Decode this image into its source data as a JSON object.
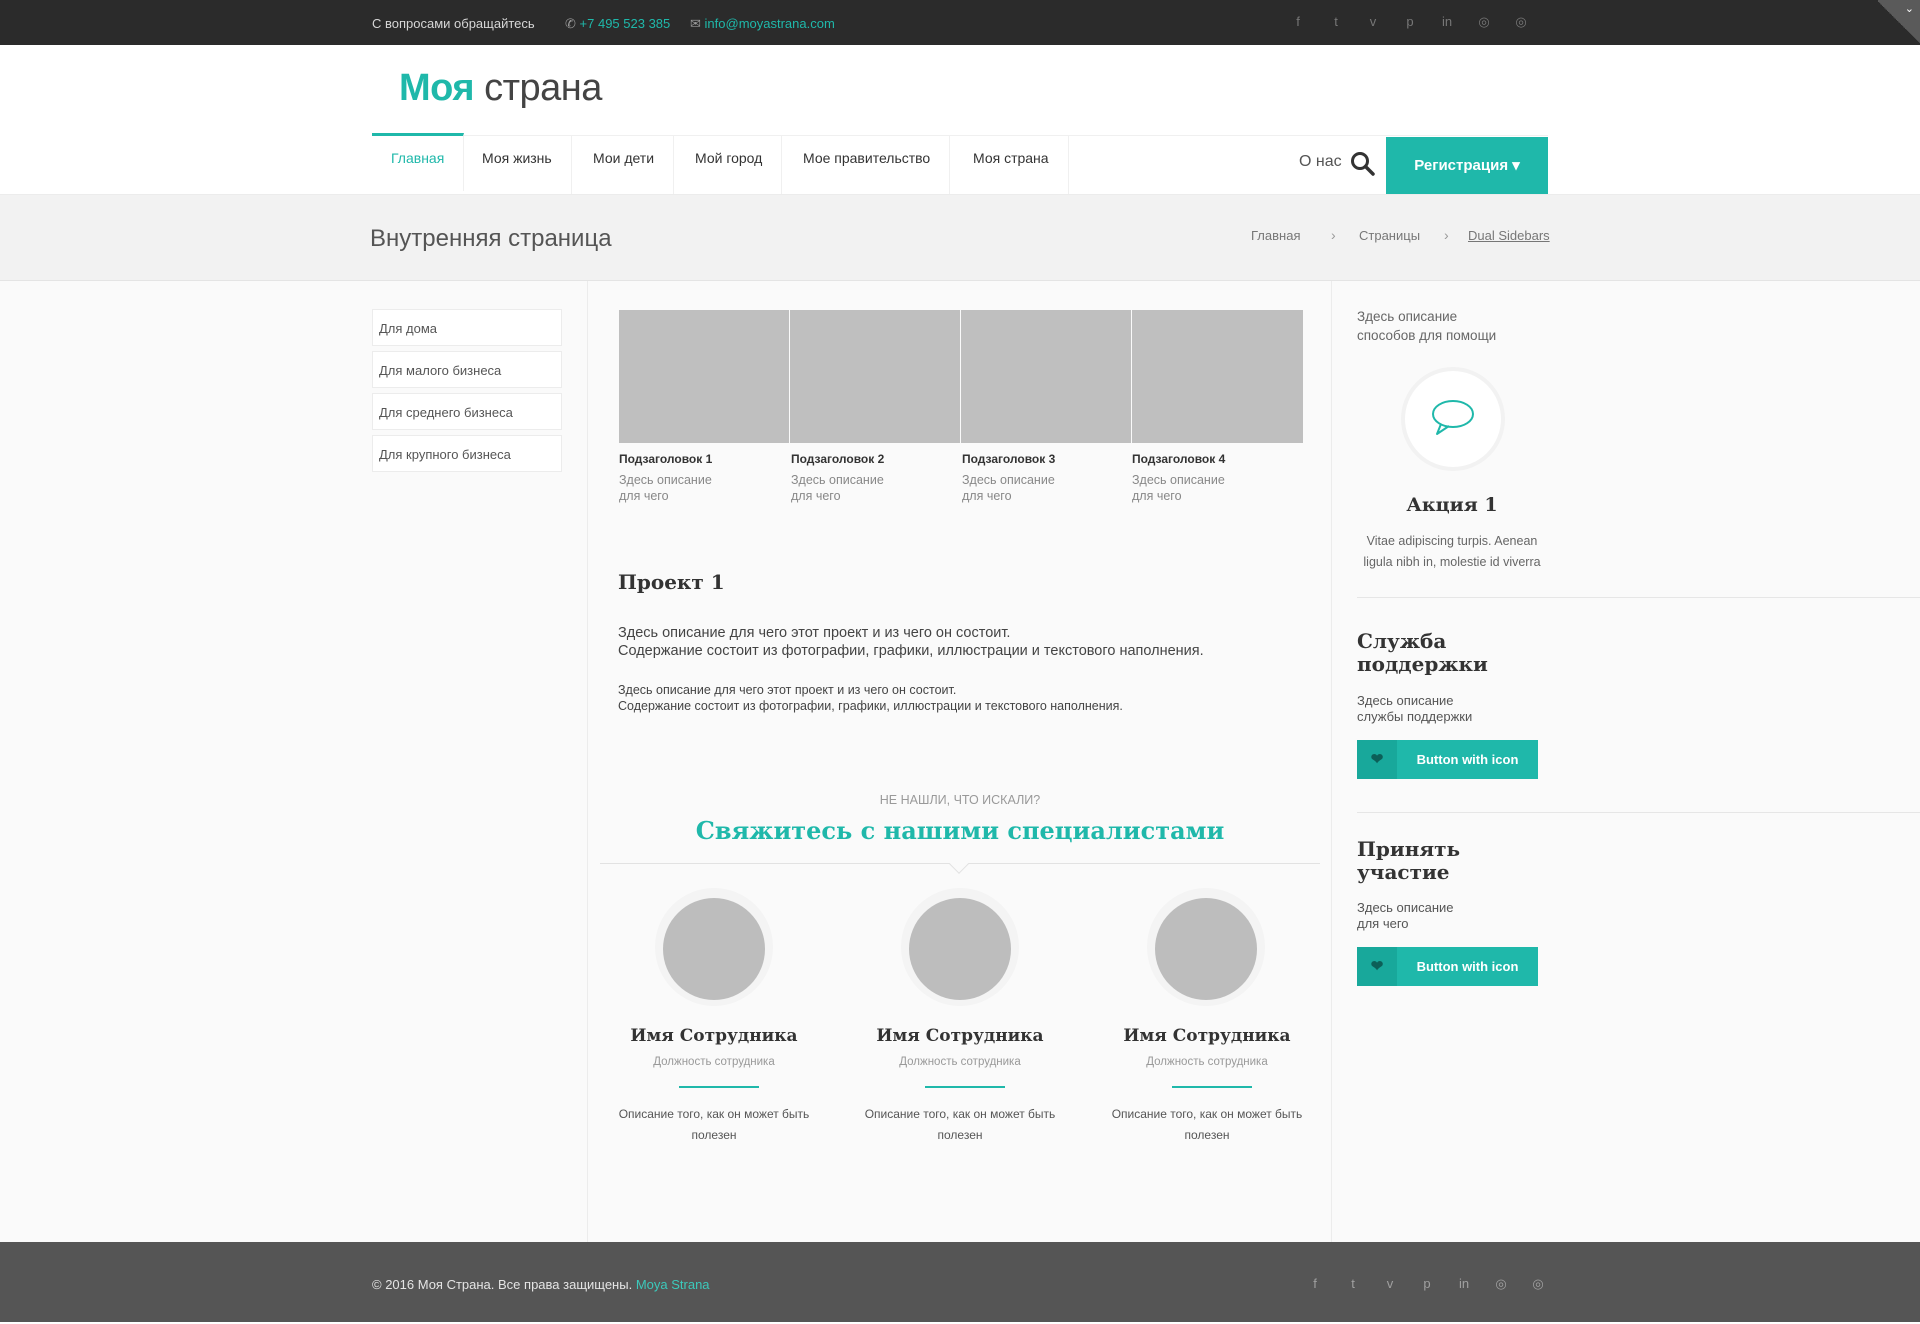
{
  "topbar": {
    "contact_text": "С вопросами обращайтесь",
    "phone": "+7 495 523 385",
    "email": "info@moyastrana.com",
    "social": [
      "facebook-icon",
      "twitter-icon",
      "vimeo-icon",
      "pinterest-icon",
      "linkedin-icon",
      "dribbble-icon",
      "dribbble-icon"
    ]
  },
  "header": {
    "logo_bold": "Моя",
    "logo_light": "страна",
    "nav": [
      "Главная",
      "Моя жизнь",
      "Мои дети",
      "Мой город",
      "Мое правительство",
      "Моя страна"
    ],
    "about": "О нас",
    "register": "Регистрация ▾"
  },
  "titlebar": {
    "title": "Внутренняя страница",
    "breadcrumb": [
      "Главная",
      "Страницы",
      "Dual Sidebars"
    ],
    "separator": "›"
  },
  "left_sidebar": {
    "items": [
      "Для дома",
      "Для малого бизнеса",
      "Для среднего бизнеса",
      "Для крупного бизнеса"
    ]
  },
  "gallery": {
    "items": [
      {
        "title": "Подзаголовок 1",
        "desc": "Здесь описание для чего"
      },
      {
        "title": "Подзаголовок 2",
        "desc": "Здесь описание для чего"
      },
      {
        "title": "Подзаголовок 3",
        "desc": "Здесь описание для чего"
      },
      {
        "title": "Подзаголовок 4",
        "desc": "Здесь описание для чего"
      }
    ]
  },
  "project": {
    "title": "Проект 1",
    "para_line1": "Здесь описание для чего этот проект и из чего он состоит.",
    "para_line2": "Содержание состоит из фотографии, графики, иллюстрации и текстового наполнения.",
    "small_line1": "Здесь описание для чего этот проект и из чего он состоит.",
    "small_line2": "Содержание состоит из фотографии, графики, иллюстрации и текстового наполнения."
  },
  "cta": {
    "subtitle": "НЕ НАШЛИ, ЧТО ИСКАЛИ?",
    "title": "Свяжитесь с нашими специалистами"
  },
  "team": [
    {
      "name": "Имя Сотрудника",
      "role": "Должность сотрудника",
      "desc_line1": "Описание того, как он может быть",
      "desc_line2": "полезен"
    },
    {
      "name": "Имя Сотрудника",
      "role": "Должность сотрудника",
      "desc_line1": "Описание того, как он может быть",
      "desc_line2": "полезен"
    },
    {
      "name": "Имя Сотрудника",
      "role": "Должность сотрудника",
      "desc_line1": "Описание того, как он может быть",
      "desc_line2": "полезен"
    }
  ],
  "right_sidebar": {
    "intro_line1": "Здесь описание",
    "intro_line2": "способов для помощи",
    "promo_icon": "speech-bubble-icon",
    "promo_title": "Акция 1",
    "promo_line1": "Vitae adipiscing turpis. Aenean",
    "promo_line2": "ligula nibh in, molestie id viverra",
    "support_title_1": "Служба",
    "support_title_2": "поддержки",
    "support_text_1": "Здесь описание",
    "support_text_2": "службы поддержки",
    "support_button": "Button with icon",
    "join_title_1": "Принять",
    "join_title_2": "участие",
    "join_text_1": "Здесь описание",
    "join_text_2": "для чего",
    "join_button": "Button with icon",
    "button_icon": "heart-icon"
  },
  "footer": {
    "copyright": "© 2016 Моя Страна. Все права защищены.",
    "brand_link": "Moya Strana"
  },
  "colors": {
    "accent": "#1fb8aa",
    "topbar_bg": "#2b2b2b",
    "footer_bg": "#555555"
  }
}
